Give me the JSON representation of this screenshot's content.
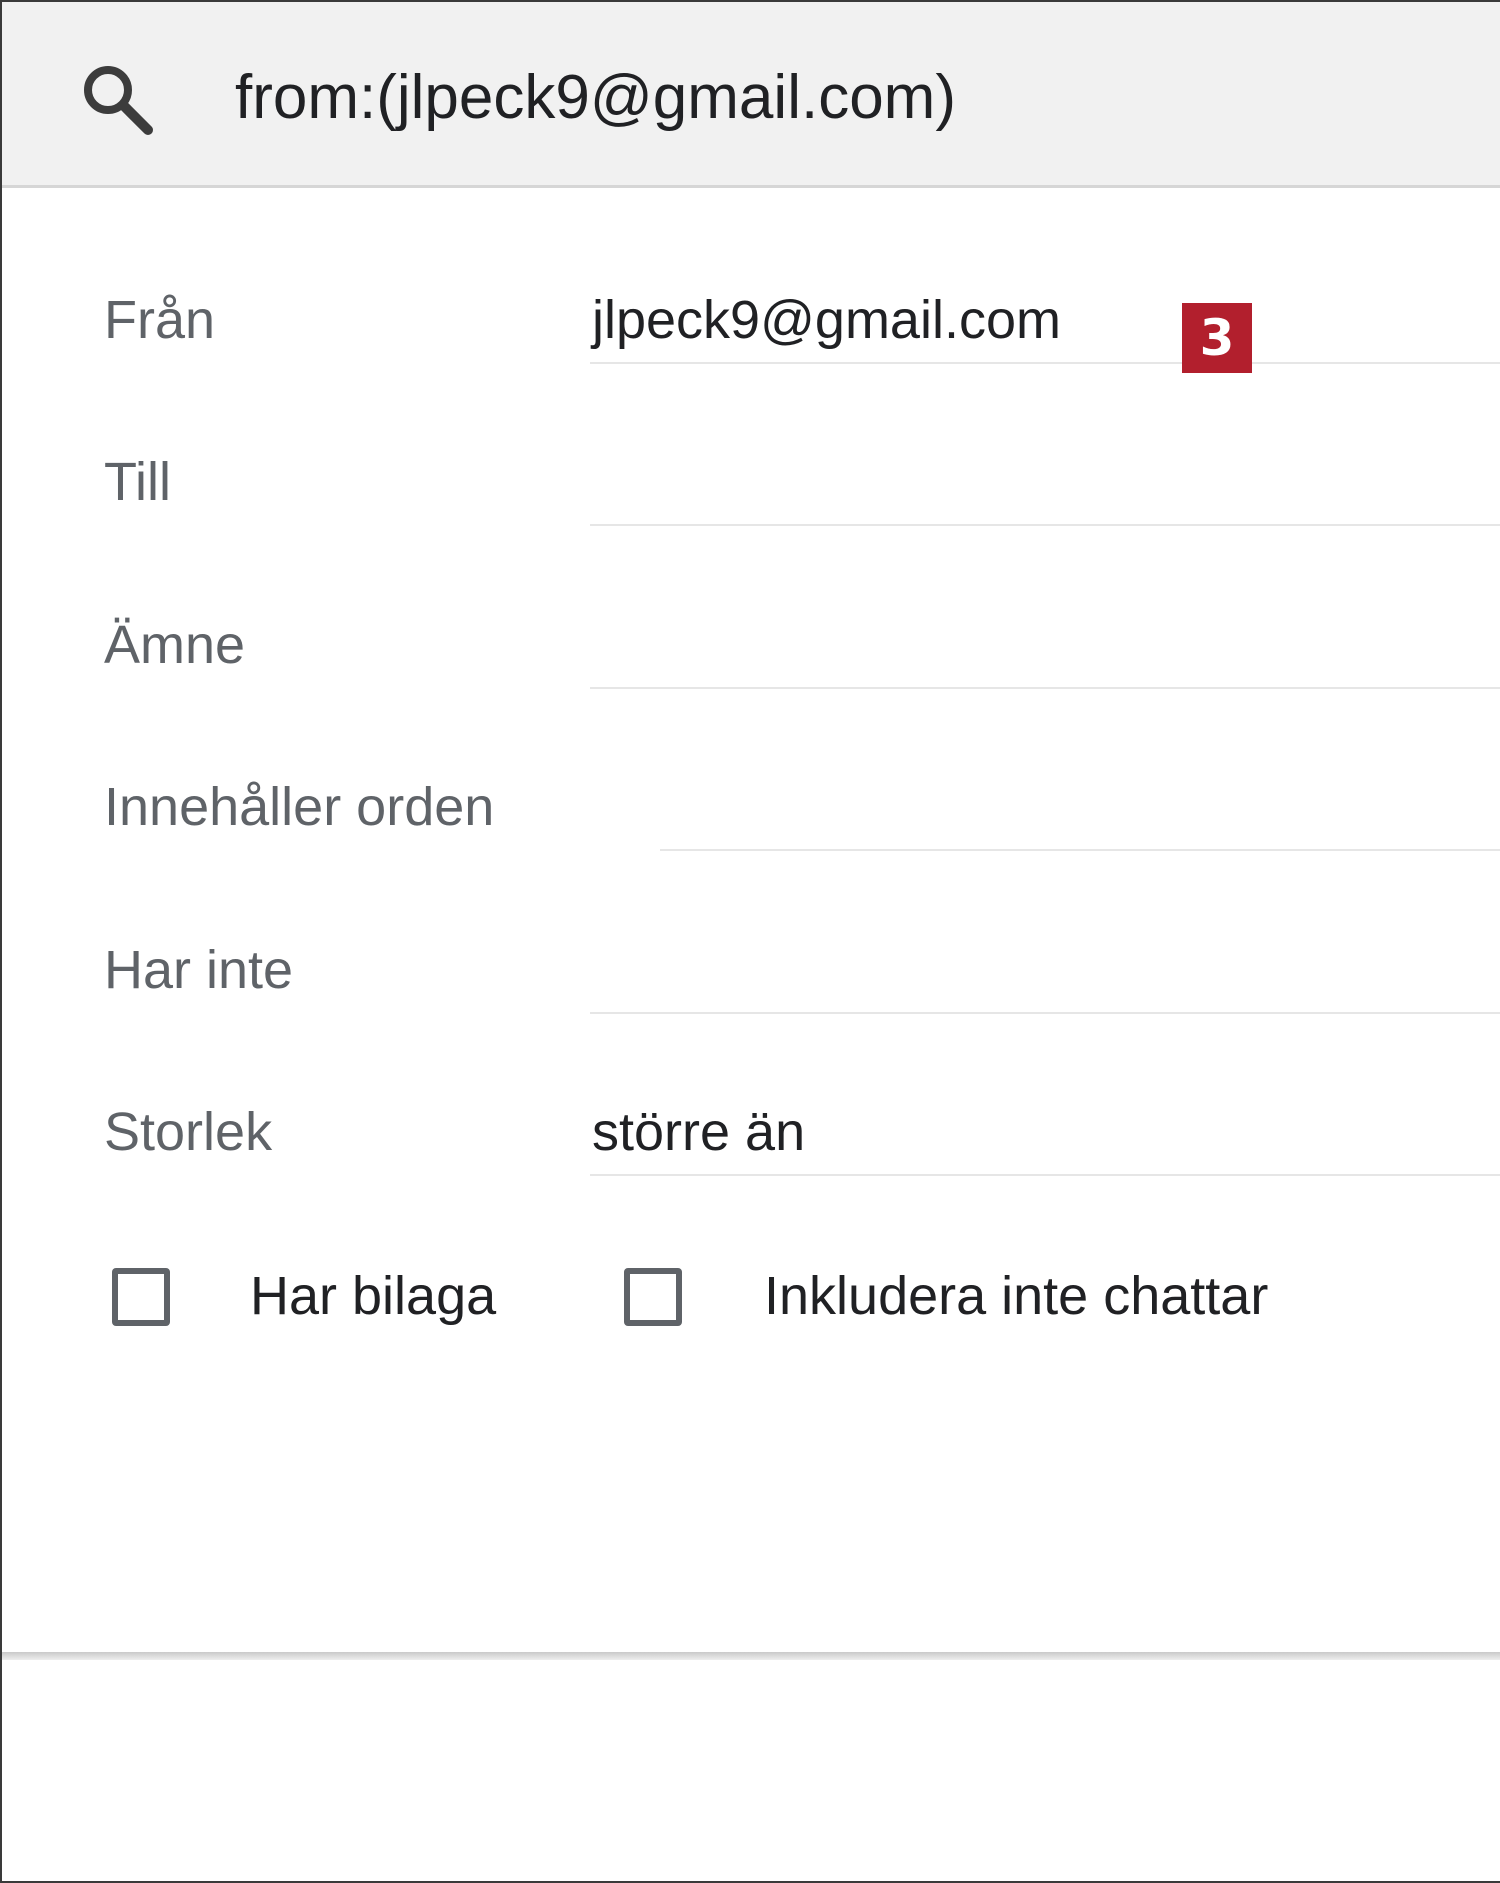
{
  "search": {
    "query": "from:(jlpeck9@gmail.com)"
  },
  "form": {
    "from_label": "Från",
    "from_value": "jlpeck9@gmail.com",
    "to_label": "Till",
    "to_value": "",
    "subject_label": "Ämne",
    "subject_value": "",
    "has_words_label": "Innehåller orden",
    "has_words_value": "",
    "doesnt_have_label": "Har inte",
    "doesnt_have_value": "",
    "size_label": "Storlek",
    "size_operator": "större än"
  },
  "checkboxes": [
    {
      "label": "Har bilaga",
      "checked": false
    },
    {
      "label": "Inkludera inte chattar",
      "checked": false
    }
  ],
  "annotation": {
    "badge_number": "3",
    "badge_color": "#b21f2d"
  }
}
